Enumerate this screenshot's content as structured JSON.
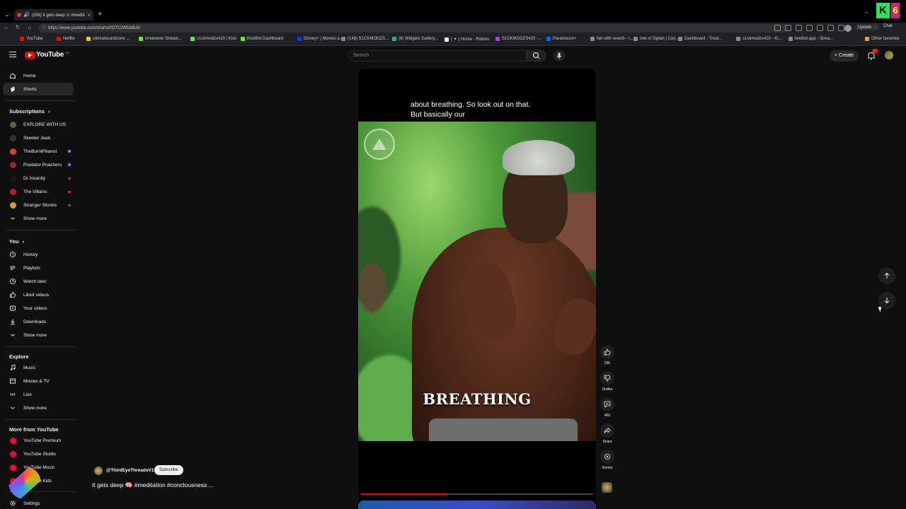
{
  "browser": {
    "tab_title": "(258) It gets deep ⊙ #meditati",
    "url": "https://www.youtube.com/shorts/0O7C2WDbBA0",
    "update_label": "Update",
    "chat_label": "Chat",
    "other_favorites": "Other favorites",
    "bookmarks": [
      {
        "label": "YouTube",
        "color": "#ff0000"
      },
      {
        "label": "Netflix",
        "color": "#e50914"
      },
      {
        "label": "ultimatecardzone ...",
        "color": "#f5c518"
      },
      {
        "label": "timdewski Stream...",
        "color": "#53fc18"
      },
      {
        "label": "s1ckmodzs420 | Kick",
        "color": "#53fc18"
      },
      {
        "label": "KickBot Dashboard",
        "color": "#53fc18"
      },
      {
        "label": "Disney+ | Movies a...",
        "color": "#113ccf"
      },
      {
        "label": "(148) S1CKMODZS...",
        "color": "#888888"
      },
      {
        "label": "(6) Widgets Gallery...",
        "color": "#2ab27b"
      },
      {
        "label": "( ✦ ) Home - Roblox",
        "color": "#ffffff"
      },
      {
        "label": "S1CKMODZS420 -...",
        "color": "#9146ff"
      },
      {
        "label": "Paramount+",
        "color": "#0064ff"
      },
      {
        "label": "fart with reverb - I...",
        "color": "#888888"
      },
      {
        "label": "Isle of Siptah | Con...",
        "color": "#888888"
      },
      {
        "label": "Dashboard - Treat...",
        "color": "#888888"
      },
      {
        "label": "s1ckmodzs420 - Ki...",
        "color": "#888888"
      },
      {
        "label": "liveBot.app - Strea...",
        "color": "#888888"
      }
    ]
  },
  "header": {
    "logo_text": "YouTube",
    "logo_country": "CA",
    "search_placeholder": "Search",
    "create_label": "Create",
    "notification_count": "9+"
  },
  "sidebar": {
    "main": [
      {
        "label": "Home",
        "icon": "home-icon"
      },
      {
        "label": "Shorts",
        "icon": "shorts-icon",
        "active": true
      }
    ],
    "subscriptions_title": "Subscriptions",
    "subscriptions": [
      {
        "label": "EXPLORE WITH US",
        "color": "#556b2f"
      },
      {
        "label": "Skeeter Jean",
        "color": "#333333"
      },
      {
        "label": "TheBurntPeanut",
        "color": "#d24b1a",
        "live": true
      },
      {
        "label": "Predator Poachers",
        "color": "#a32020",
        "live": true
      },
      {
        "label": "Dr Insanity",
        "color": "#1a1a1a"
      },
      {
        "label": "The Villains",
        "color": "#b22222"
      },
      {
        "label": "Stranger Stories",
        "color": "#c9a227"
      }
    ],
    "show_more": "Show more",
    "you_title": "You",
    "you_items": [
      {
        "label": "History",
        "icon": "history-icon"
      },
      {
        "label": "Playlists",
        "icon": "playlists-icon"
      },
      {
        "label": "Watch later",
        "icon": "watch-later-icon"
      },
      {
        "label": "Liked videos",
        "icon": "liked-videos-icon"
      },
      {
        "label": "Your videos",
        "icon": "your-videos-icon"
      },
      {
        "label": "Downloads",
        "icon": "downloads-icon"
      }
    ],
    "explore_title": "Explore",
    "explore_items": [
      {
        "label": "Music",
        "icon": "music-icon"
      },
      {
        "label": "Movies & TV",
        "icon": "movies-icon"
      },
      {
        "label": "Live",
        "icon": "live-icon"
      }
    ],
    "more_title": "More from YouTube",
    "more_items": [
      {
        "label": "YouTube Premium",
        "color": "#ff0033"
      },
      {
        "label": "YouTube Studio",
        "color": "#ff0033"
      },
      {
        "label": "YouTube Music",
        "color": "#ff0033"
      },
      {
        "label": "YouTube Kids",
        "color": "#ff0033"
      }
    ],
    "settings_label": "Settings"
  },
  "short": {
    "caption_line1": "about breathing. So look out on that.",
    "caption_line2": "But basically our",
    "overlay_word": "BREATHING",
    "channel": "@ThirdEyeThreadsV1",
    "subscribe_label": "Subscribe",
    "title": "It gets deep 🧠 #meditation #conclousness ...",
    "progress": 0.37
  },
  "actions": {
    "like_count": "19K",
    "dislike_label": "Dislike",
    "comment_count": "460",
    "share_label": "Share",
    "remix_label": "Remix"
  }
}
